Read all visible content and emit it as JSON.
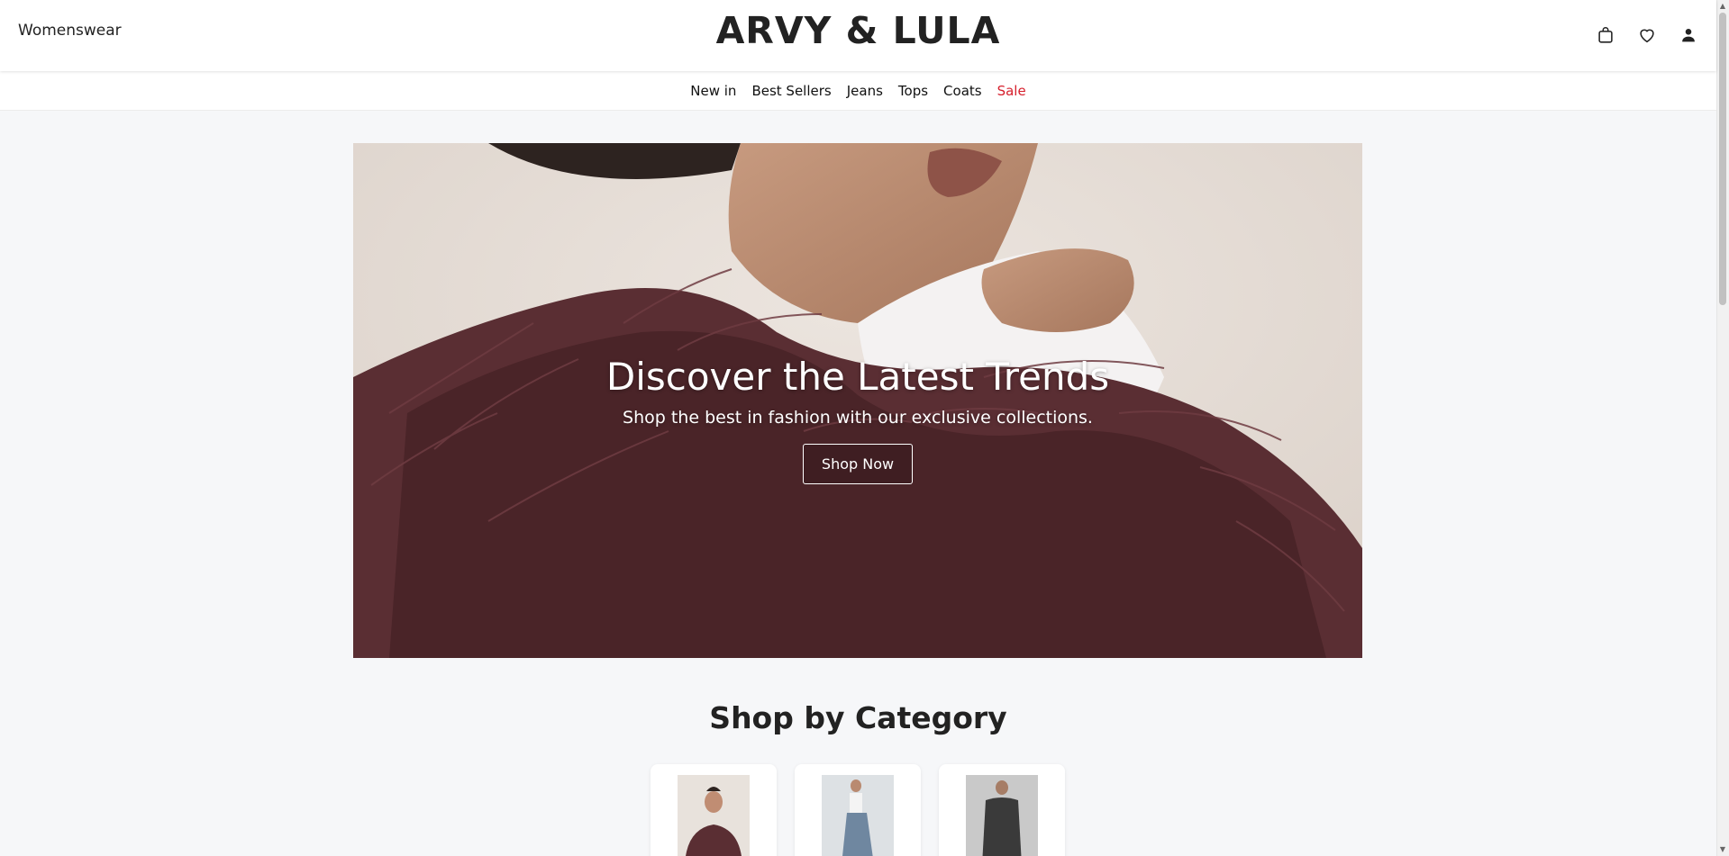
{
  "header": {
    "section_label": "Womenswear",
    "logo": "ARVY & LULA",
    "icons": [
      "shopping-bag-icon",
      "heart-icon",
      "user-icon"
    ]
  },
  "nav": {
    "items": [
      {
        "label": "New in"
      },
      {
        "label": "Best Sellers"
      },
      {
        "label": "Jeans"
      },
      {
        "label": "Tops"
      },
      {
        "label": "Coats"
      },
      {
        "label": "Sale"
      }
    ],
    "sale_color": "#d61f2c"
  },
  "hero": {
    "title": "Discover the Latest Trends",
    "subtitle": "Shop the best in fashion with our exclusive collections.",
    "cta": "Shop Now"
  },
  "categories": {
    "title": "Shop by Category"
  },
  "colors": {
    "background": "#f6f7f9",
    "header": "#ffffff",
    "feather": "#5a2e33",
    "accent_sale": "#d61f2c"
  }
}
